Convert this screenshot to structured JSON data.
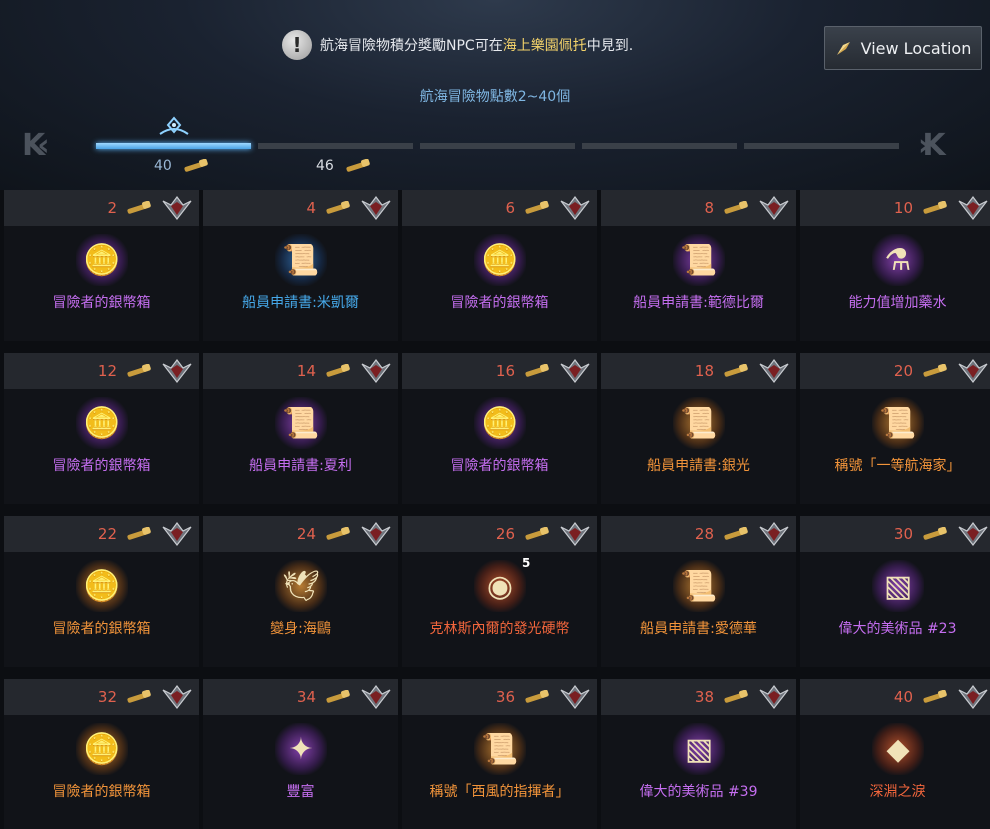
{
  "notice": {
    "icon": "exclamation-icon",
    "prefix": "航海冒險物積分獎勵NPC可在",
    "highlight": "海上樂園佩托",
    "suffix": "中見到."
  },
  "view_location": {
    "label": "View Location",
    "icon": "compass-needle-icon"
  },
  "range_text": "航海冒險物點數2~40個",
  "progress": {
    "current": "40",
    "next": "46",
    "active_segments": 1,
    "total_segments": 5
  },
  "colors": {
    "purple": "#c56ef0",
    "blue": "#46a9ea",
    "orange": "#f2943a",
    "red": "#f2663c",
    "points": "#e0614e",
    "highlight": "#f3d26a"
  },
  "rewards": [
    {
      "points": "2",
      "name": "冒險者的銀幣箱",
      "icon": "silver-coin-chest-icon",
      "grade": "purple"
    },
    {
      "points": "4",
      "name": "船員申請書:米凱爾",
      "icon": "crew-application-scroll-icon",
      "grade": "blue"
    },
    {
      "points": "6",
      "name": "冒險者的銀幣箱",
      "icon": "silver-coin-chest-icon",
      "grade": "purple"
    },
    {
      "points": "8",
      "name": "船員申請書:範德比爾",
      "icon": "crew-application-scroll-icon",
      "grade": "purple"
    },
    {
      "points": "10",
      "name": "能力值增加藥水",
      "icon": "potion-icon",
      "grade": "purple"
    },
    {
      "points": "12",
      "name": "冒險者的銀幣箱",
      "icon": "silver-coin-chest-icon",
      "grade": "purple"
    },
    {
      "points": "14",
      "name": "船員申請書:夏利",
      "icon": "crew-application-scroll-icon",
      "grade": "purple"
    },
    {
      "points": "16",
      "name": "冒險者的銀幣箱",
      "icon": "silver-coin-chest-icon",
      "grade": "purple"
    },
    {
      "points": "18",
      "name": "船員申請書:銀光",
      "icon": "crew-application-scroll-icon",
      "grade": "orange"
    },
    {
      "points": "20",
      "name": "稱號「一等航海家」",
      "icon": "title-scroll-icon",
      "grade": "orange"
    },
    {
      "points": "22",
      "name": "冒險者的銀幣箱",
      "icon": "silver-coin-chest-icon",
      "grade": "orange"
    },
    {
      "points": "24",
      "name": "變身:海鷗",
      "icon": "seagull-icon",
      "grade": "orange"
    },
    {
      "points": "26",
      "name": "克林斯內爾的發光硬幣",
      "icon": "glowing-coin-icon",
      "grade": "red",
      "badge": "5"
    },
    {
      "points": "28",
      "name": "船員申請書:愛德華",
      "icon": "crew-application-scroll-icon",
      "grade": "orange"
    },
    {
      "points": "30",
      "name": "偉大的美術品 #23",
      "icon": "painting-icon",
      "grade": "purple"
    },
    {
      "points": "32",
      "name": "冒險者的銀幣箱",
      "icon": "silver-coin-chest-icon",
      "grade": "orange"
    },
    {
      "points": "34",
      "name": "豐富",
      "icon": "emote-card-icon",
      "grade": "purple"
    },
    {
      "points": "36",
      "name": "稱號「西風的指揮者」",
      "icon": "title-scroll-icon",
      "grade": "orange"
    },
    {
      "points": "38",
      "name": "偉大的美術品 #39",
      "icon": "painting-icon",
      "grade": "purple"
    },
    {
      "points": "40",
      "name": "深淵之淚",
      "icon": "gem-icon",
      "grade": "red"
    }
  ]
}
